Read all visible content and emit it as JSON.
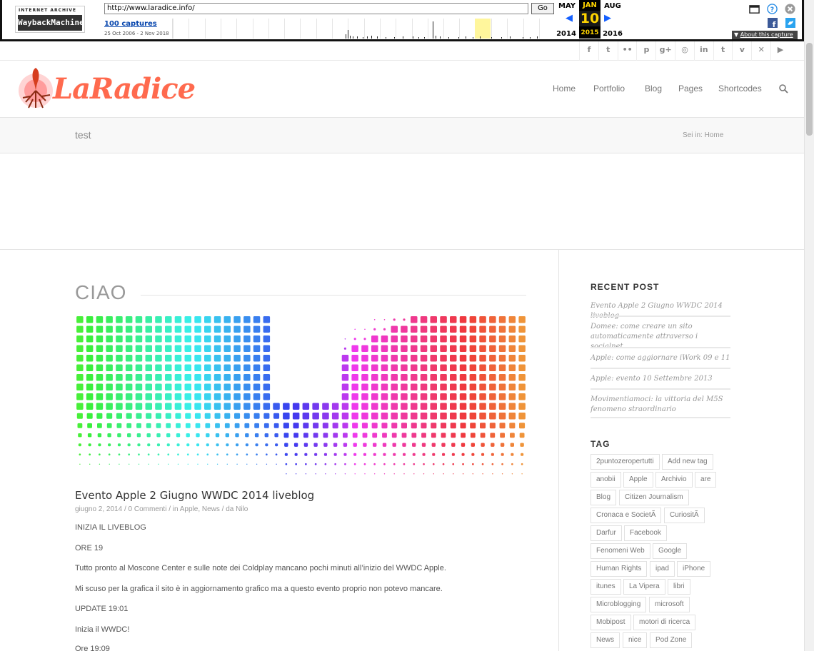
{
  "wayback": {
    "logo_top": "INTERNET ARCHIVE",
    "logo_bottom": "WaybackMachine",
    "url": "http://www.laradice.info/",
    "go": "Go",
    "captures": "100 captures",
    "range": "25 Oct 2006 - 2 Nov 2018",
    "prev_month": "MAY",
    "cur_month": "JAN",
    "next_month": "AUG",
    "prev_year": "2014",
    "cur_day": "10",
    "cur_year": "2015",
    "next_year": "2016",
    "about": "About this capture",
    "prev_arrow": "◀",
    "next_arrow": "▶"
  },
  "social": [
    "f",
    "t",
    "••",
    "p",
    "g+",
    "◎",
    "in",
    "t",
    "v",
    "✕",
    "▶"
  ],
  "logo": {
    "text": "LaRadice"
  },
  "nav": [
    "Home",
    "Portfolio",
    "Blog",
    "Pages",
    "Shortcodes"
  ],
  "titlebar": {
    "title": "test",
    "breadcrumb_prefix": "Sei in:",
    "breadcrumb_home": "Home"
  },
  "main": {
    "heading": "CIAO",
    "post_title": "Evento Apple 2 Giugno WWDC 2014 liveblog",
    "post_meta": "giugno 2, 2014  /  0 Commenti  /  in Apple, News  /  da Nilo",
    "paragraphs": [
      "INIZIA IL LIVEBLOG",
      "ORE 19",
      "Tutto pronto al Moscone Center e sulle note dei Coldplay mancano pochi minuti all’inizio del WWDC Apple.",
      "Mi scuso per la grafica il sito è in aggiornamento grafico ma a questo evento proprio non potevo mancare.",
      "UPDATE 19:01",
      "Inizia il WWDC!",
      "Ore 19:09"
    ]
  },
  "sidebar": {
    "recent_heading": "RECENT POST",
    "recent": [
      "Evento Apple 2 Giugno WWDC 2014 liveblog",
      "Domee: come creare un sito automaticamente attraverso i socialnet",
      "Apple: come aggiornare iWork 09 e 11",
      "Apple: evento 10 Settembre 2013",
      "Movimentiamoci: la vittoria del M5S fenomeno straordinario"
    ],
    "tag_heading": "TAG",
    "tags": [
      [
        "2puntozeropertutti",
        "Add new tag"
      ],
      [
        "anobii",
        "Apple",
        "Archivio",
        "are"
      ],
      [
        "Blog",
        "Citizen Journalism"
      ],
      [
        "Cronaca e SocietÃ",
        "CuriositÃ"
      ],
      [
        "Darfur",
        "Facebook"
      ],
      [
        "Fenomeni Web",
        "Google"
      ],
      [
        "Human Rights",
        "ipad",
        "iPhone"
      ],
      [
        "itunes",
        "La Vipera",
        "libri"
      ],
      [
        "Microblogging",
        "microsoft"
      ],
      [
        "Mobipost",
        "motori di ricerca"
      ],
      [
        "News",
        "nice",
        "Pod Zone"
      ]
    ]
  },
  "colors": {
    "accent": "#ff6a4e",
    "highlight": "#fff69c"
  }
}
